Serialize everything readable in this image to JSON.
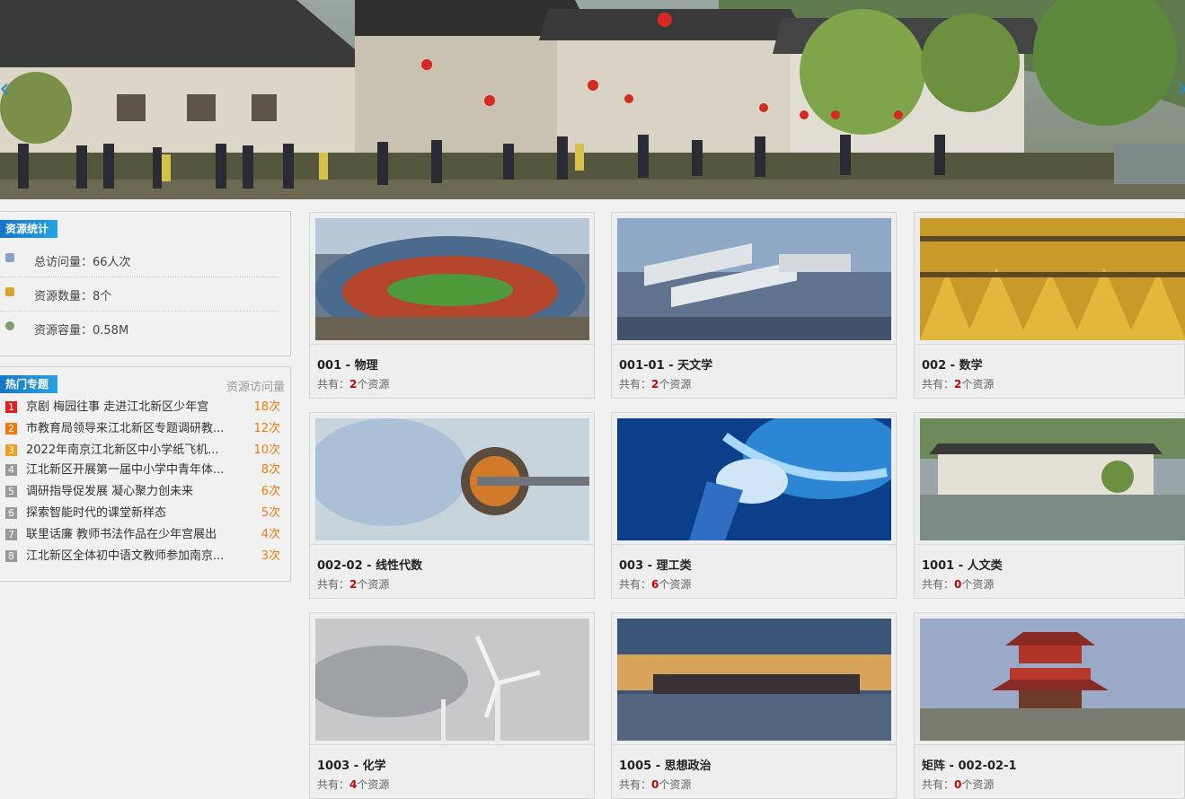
{
  "banner": {
    "prev_label": "‹",
    "next_label": "›"
  },
  "stats": {
    "title": "资源统计",
    "rows": [
      {
        "label": "总访问量：66人次",
        "icon": "document-icon"
      },
      {
        "label": "资源数量：8个",
        "icon": "folder-icon"
      },
      {
        "label": "资源容量：0.58M",
        "icon": "disk-icon"
      }
    ]
  },
  "hot": {
    "title": "热门专题",
    "subtitle": "资源访问量",
    "items": [
      {
        "rank": "1",
        "title": "京剧 梅园往事 走进江北新区少年宫",
        "count": "18次",
        "color": "#e02020"
      },
      {
        "rank": "2",
        "title": "市教育局领导来江北新区专题调研教...",
        "count": "12次",
        "color": "#f07a10"
      },
      {
        "rank": "3",
        "title": "2022年南京江北新区中小学纸飞机...",
        "count": "10次",
        "color": "#f0a020"
      },
      {
        "rank": "4",
        "title": "江北新区开展第一届中小学中青年体...",
        "count": "8次",
        "color": "#9a9a9a"
      },
      {
        "rank": "5",
        "title": "调研指导促发展 凝心聚力创未来",
        "count": "6次",
        "color": "#9a9a9a"
      },
      {
        "rank": "6",
        "title": "探索智能时代的课堂新样态",
        "count": "5次",
        "color": "#9a9a9a"
      },
      {
        "rank": "7",
        "title": "联里话廉 教师书法作品在少年宫展出",
        "count": "4次",
        "color": "#9a9a9a"
      },
      {
        "rank": "8",
        "title": "江北新区全体初中语文教师参加南京...",
        "count": "3次",
        "color": "#9a9a9a"
      }
    ]
  },
  "cards": [
    {
      "name": "001 - 物理",
      "meta_prefix": "共有：",
      "count": "2",
      "meta_suffix": "个资源"
    },
    {
      "name": "001-01 - 天文学",
      "meta_prefix": "共有：",
      "count": "2",
      "meta_suffix": "个资源"
    },
    {
      "name": "002 - 数学",
      "meta_prefix": "共有：",
      "count": "2",
      "meta_suffix": "个资源"
    },
    {
      "name": "002-02 - 线性代数",
      "meta_prefix": "共有：",
      "count": "2",
      "meta_suffix": "个资源"
    },
    {
      "name": "003 - 理工类",
      "meta_prefix": "共有：",
      "count": "6",
      "meta_suffix": "个资源"
    },
    {
      "name": "1001 - 人文类",
      "meta_prefix": "共有：",
      "count": "0",
      "meta_suffix": "个资源"
    },
    {
      "name": "1003 - 化学",
      "meta_prefix": "共有：",
      "count": "4",
      "meta_suffix": "个资源"
    },
    {
      "name": "1005 - 思想政治",
      "meta_prefix": "共有：",
      "count": "0",
      "meta_suffix": "个资源"
    },
    {
      "name": "矩阵 - 002-02-1",
      "meta_prefix": "共有：",
      "count": "0",
      "meta_suffix": "个资源"
    }
  ]
}
